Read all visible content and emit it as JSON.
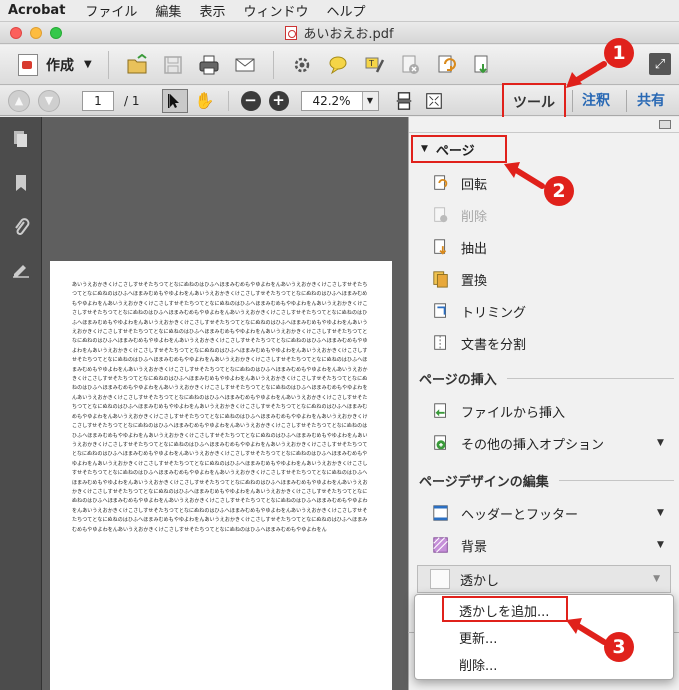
{
  "menubar": {
    "app": "Acrobat",
    "items": [
      "ファイル",
      "編集",
      "表示",
      "ウィンドウ",
      "ヘルプ"
    ]
  },
  "window": {
    "title": "あいおえお.pdf"
  },
  "toolbar": {
    "create_label": "作成"
  },
  "nav": {
    "page_current": "1",
    "page_total": "/ 1",
    "zoom": "42.2%"
  },
  "tabs": {
    "tools": "ツール",
    "comment": "注釈",
    "share": "共有"
  },
  "panel": {
    "pages_section": "ページ",
    "page_items": [
      {
        "label": "回転",
        "icon": "rotate-icon",
        "enabled": true
      },
      {
        "label": "削除",
        "icon": "delete-page-icon",
        "enabled": false
      },
      {
        "label": "抽出",
        "icon": "extract-icon",
        "enabled": true
      },
      {
        "label": "置換",
        "icon": "replace-icon",
        "enabled": true
      },
      {
        "label": "トリミング",
        "icon": "crop-icon",
        "enabled": true
      },
      {
        "label": "文書を分割",
        "icon": "split-icon",
        "enabled": true
      }
    ],
    "insert_group": "ページの挿入",
    "insert_items": [
      {
        "label": "ファイルから挿入",
        "icon": "insert-file-icon"
      },
      {
        "label": "その他の挿入オプション",
        "icon": "insert-options-icon"
      }
    ],
    "design_group": "ページデザインの編集",
    "design_items": [
      {
        "label": "ヘッダーとフッター",
        "icon": "header-footer-icon"
      },
      {
        "label": "背景",
        "icon": "background-icon"
      }
    ],
    "watermark_label": "透かし"
  },
  "watermark_menu": {
    "add": "透かしを追加...",
    "update": "更新...",
    "remove": "削除..."
  },
  "callouts": [
    "1",
    "2",
    "3"
  ],
  "document": {
    "body_text": "あいうえおかきくけこさしすせそたちつてとなにぬねのはひふへほまみむめもやゆよわをんあいうえおかきくけこさしすせそたちつてとなにぬねのはひふへほまみむめもやゆよわをんあいうえおかきくけこさしすせそたちつてとなにぬねのはひふへほまみむめもやゆよわをんあいうえおかきくけこさしすせそたちつてとなにぬねのはひふへほまみむめもやゆよわをんあいうえおかきくけこさしすせそたちつてとなにぬねのはひふへほまみむめもやゆよわをんあいうえおかきくけこさしすせそたちつてとなにぬねのはひふへほまみむめもやゆよわをんあいうえおかきくけこさしすせそたちつてとなにぬねのはひふへほまみむめもやゆよわをんあいうえおかきくけこさしすせそたちつてとなにぬねのはひふへほまみむめもやゆよわをんあいうえおかきくけこさしすせそたちつてとなにぬねのはひふへほまみむめもやゆよわをんあいうえおかきくけこさしすせそたちつてとなにぬねのはひふへほまみむめもやゆよわをんあいうえおかきくけこさしすせそたちつてとなにぬねのはひふへほまみむめもやゆよわをんあいうえおかきくけこさしすせそたちつてとなにぬねのはひふへほまみむめもやゆよわをんあいうえおかきくけこさしすせそたちつてとなにぬねのはひふへほまみむめもやゆよわをんあいうえおかきくけこさしすせそたちつてとなにぬねのはひふへほまみむめもやゆよわをんあいうえおかきくけこさしすせそたちつてとなにぬねのはひふへほまみむめもやゆよわをんあいうえおかきくけこさしすせそたちつてとなにぬねのはひふへほまみむめもやゆよわをんあいうえおかきくけこさしすせそたちつてとなにぬねのはひふへほまみむめもやゆよわをんあいうえおかきくけこさしすせそたちつてとなにぬねのはひふへほまみむめもやゆよわをんあいうえおかきくけこさしすせそたちつてとなにぬねのはひふへほまみむめもやゆよわをんあいうえおかきくけこさしすせそたちつてとなにぬねのはひふへほまみむめもやゆよわをんあいうえおかきくけこさしすせそたちつてとなにぬねのはひふへほまみむめもやゆよわをんあいうえおかきくけこさしすせそたちつてとなにぬねのはひふへほまみむめもやゆよわをんあいうえおかきくけこさしすせそたちつてとなにぬねのはひふへほまみむめもやゆよわをんあいうえおかきくけこさしすせそたちつてとなにぬねのはひふへほまみむめもやゆよわをんあいうえおかきくけこさしすせそたちつてとなにぬねのはひふへほまみむめもやゆよわをんあいうえおかきくけこさしすせそたちつてとなにぬねのはひふへほまみむめもやゆよわをんあいうえおかきくけこさしすせそたちつてとなにぬねのはひふへほまみむめもやゆよわをんあいうえおかきくけこさしすせそたちつてとなにぬねのはひふへほまみむめもやゆよわをんあいうえおかきくけこさしすせそたちつてとなにぬねのはひふへほまみむめもやゆよわをんあいうえおかきくけこさしすせそたちつてとなにぬねのはひふへほまみむめもやゆよわをんあいうえおかきくけこさしすせそたちつてとなにぬねのはひふへほまみむめもやゆよわをんあいうえおかきくけこさしすせそたちつてとなにぬねのはひふへほまみむめもやゆよわをんあいうえおかきくけこさしすせそたちつてとなにぬねのはひふへほまみむめもやゆよわをんあいうえおかきくけこさしすせそたちつてとなにぬねのはひふへほまみむめもやゆよわをんあいうえおかきくけこさしすせそたちつてとなにぬねのはひふへほまみむめもやゆよわをんあいうえおかきくけこさしすせそたちつてとなにぬねのはひふへほまみむめもやゆよわをんあいうえおかきくけこさしすせそたちつてとなにぬねのはひふへほまみむめもやゆよわをんあいうえおかきくけこさしすせそたちつてとなにぬねのはひふへほまみむめもやゆよわをん"
  },
  "colors": {
    "annotation_red": "#e0211b",
    "tab_blue": "#2868b4"
  }
}
